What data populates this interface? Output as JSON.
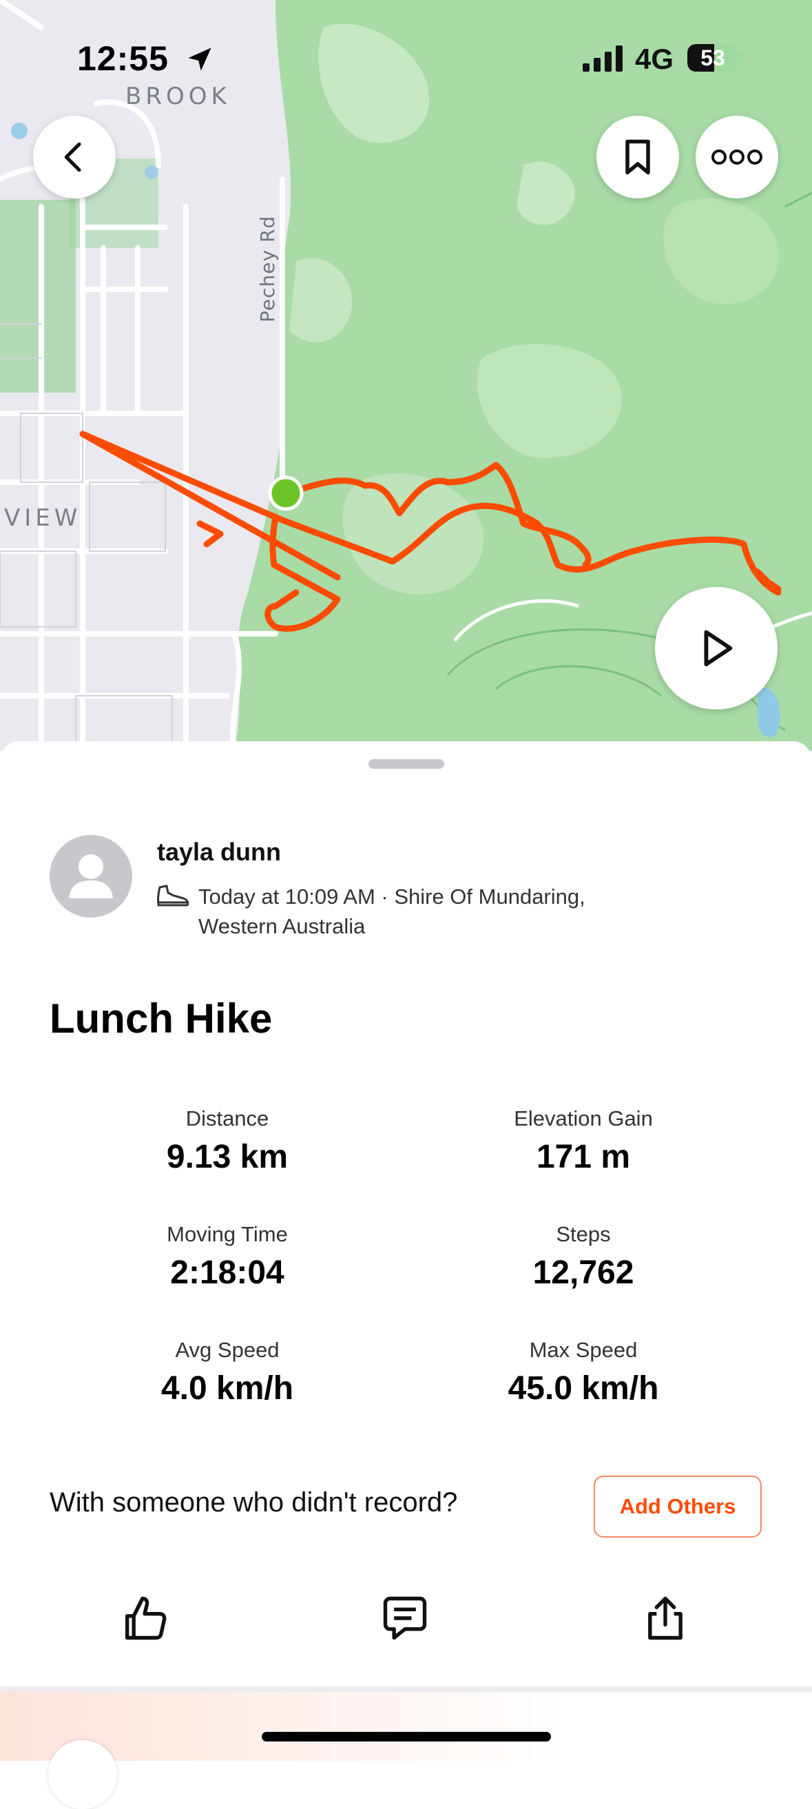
{
  "status_bar": {
    "time": "12:55",
    "network": "4G",
    "battery_percent": 53,
    "battery_label": "53"
  },
  "map": {
    "labels": {
      "suburb_top": "BROOK",
      "suburb_left": "VIEW",
      "road": "Pechey Rd"
    },
    "colors": {
      "route": "#fc4c02",
      "start_marker": "#6cc528",
      "bush": "#a8dba5",
      "urban": "#ececf1"
    },
    "icons": [
      "back-arrow-icon",
      "bookmark-icon",
      "more-icon",
      "play-icon"
    ]
  },
  "activity": {
    "athlete_name": "tayla dunn",
    "meta_line1": "Today at 10:09 AM · Shire Of Mundaring,",
    "meta_line2": "Western Australia",
    "title": "Lunch Hike",
    "stats": [
      {
        "label": "Distance",
        "value": "9.13 km"
      },
      {
        "label": "Elevation Gain",
        "value": "171 m"
      },
      {
        "label": "Moving Time",
        "value": "2:18:04"
      },
      {
        "label": "Steps",
        "value": "12,762"
      },
      {
        "label": "Avg Speed",
        "value": "4.0 km/h"
      },
      {
        "label": "Max Speed",
        "value": "45.0 km/h"
      }
    ]
  },
  "prompt": {
    "text": "With someone who didn't record?",
    "button_label": "Add Others"
  },
  "actions": {
    "icons": [
      "thumbs-up-icon",
      "comment-icon",
      "share-icon"
    ]
  }
}
